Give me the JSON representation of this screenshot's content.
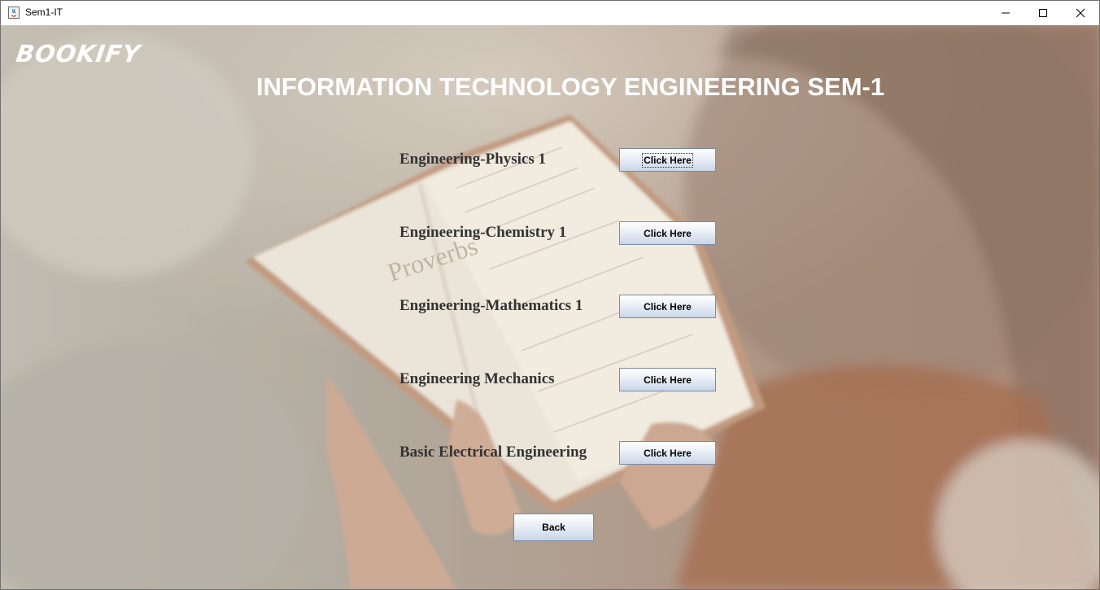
{
  "window": {
    "title": "Sem1-IT",
    "controls": [
      "minimize-icon",
      "maximize-icon",
      "close-icon"
    ]
  },
  "app": {
    "logo": "BOOKIFY",
    "page_title": "INFORMATION TECHNOLOGY ENGINEERING SEM-1"
  },
  "subjects": [
    {
      "label": "Engineering-Physics 1",
      "button": "Click Here"
    },
    {
      "label": "Engineering-Chemistry 1",
      "button": "Click Here"
    },
    {
      "label": "Engineering-Mathematics 1",
      "button": "Click Here"
    },
    {
      "label": "Engineering Mechanics",
      "button": "Click Here"
    },
    {
      "label": "Basic Electrical Engineering",
      "button": "Click Here"
    }
  ],
  "back_button": "Back",
  "background": {
    "description_icon": "woman-reading-book-photo",
    "book_text": "Proverbs"
  },
  "colors": {
    "title_text": "#ffffff",
    "subject_text": "#333333",
    "button_gradient_top": "#ffffff",
    "button_gradient_bottom": "#c9d6e8"
  }
}
